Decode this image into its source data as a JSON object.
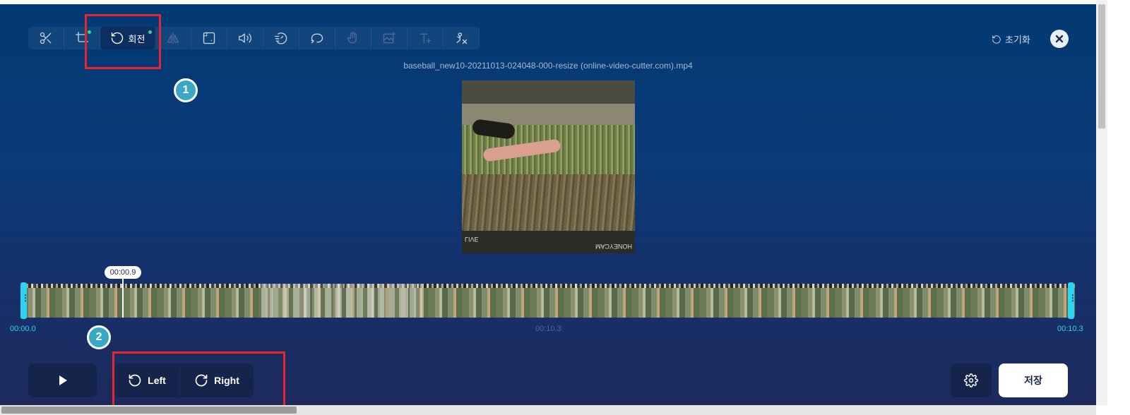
{
  "toolbar": {
    "tools": [
      {
        "name": "cut",
        "icon": "scissors-icon"
      },
      {
        "name": "crop",
        "icon": "crop-icon",
        "modified": true
      },
      {
        "name": "rotate",
        "icon": "rotate-ccw-icon",
        "label": "회전",
        "active": true,
        "modified": true
      },
      {
        "name": "flip",
        "icon": "flip-icon",
        "disabled": true
      },
      {
        "name": "resize",
        "icon": "frame-icon"
      },
      {
        "name": "volume",
        "icon": "volume-icon"
      },
      {
        "name": "speed",
        "icon": "speed-icon"
      },
      {
        "name": "loop",
        "icon": "loop-icon"
      },
      {
        "name": "stabilize",
        "icon": "stabilize-icon",
        "disabled": true
      },
      {
        "name": "add-image",
        "icon": "add-image-icon",
        "disabled": true
      },
      {
        "name": "add-text",
        "icon": "add-text-icon",
        "disabled": true
      },
      {
        "name": "remove-logo",
        "icon": "remove-logo-icon"
      }
    ],
    "reset_label": "초기화"
  },
  "filename": "baseball_new10-20211013-024048-000-resize (online-video-cutter.com).mp4",
  "video": {
    "watermark_left": "LIVE",
    "watermark_right": "HONEYCAM"
  },
  "timeline": {
    "playhead_time": "00:00.9",
    "playhead_fraction": 0.09,
    "start_time": "00:00.0",
    "duration_label": "00:10.3",
    "end_time": "00:10.3"
  },
  "controls": {
    "rotate_left_label": "Left",
    "rotate_right_label": "Right",
    "save_label": "저장"
  },
  "annotations": {
    "badge1": "1",
    "badge2": "2",
    "color": "#e8242e"
  },
  "colors": {
    "accent_cyan": "#2fd3f3",
    "modified_dot": "#28e07a"
  }
}
